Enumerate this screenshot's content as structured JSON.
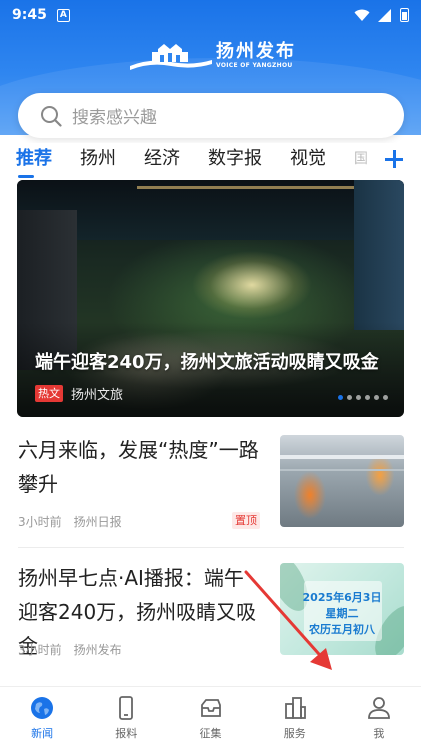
{
  "status_bar": {
    "time": "9:45",
    "notification_badge": "A"
  },
  "header": {
    "logo_title": "扬州发布",
    "logo_subtitle": "VOICE OF YANGZHOU",
    "brand_color": "#1a73e8"
  },
  "search": {
    "placeholder": "搜索感兴趣",
    "icon": "search-icon"
  },
  "tabs": {
    "items": [
      {
        "label": "推荐",
        "active": true
      },
      {
        "label": "扬州",
        "active": false
      },
      {
        "label": "经济",
        "active": false
      },
      {
        "label": "数字报",
        "active": false
      },
      {
        "label": "视觉",
        "active": false
      },
      {
        "label": "国",
        "active": false
      }
    ],
    "add_icon": "plus-icon"
  },
  "hero": {
    "title": "端午迎客240万，扬州文旅活动吸睛又吸金",
    "tag": "热文",
    "source": "扬州文旅",
    "slide_count": 6,
    "active_slide": 1
  },
  "news": [
    {
      "title": "六月来临，发展“热度”一路攀升",
      "time": "3小时前",
      "source": "扬州日报",
      "tag": "置顶",
      "thumb": "factory-robots-image"
    },
    {
      "title": "扬州早七点·AI播报：端午迎客240万，扬州吸睛又吸金",
      "time": "3小时前",
      "source": "扬州发布",
      "thumb": "calendar-image",
      "thumb_text": {
        "date": "2025年6月3日",
        "weekday": "星期二",
        "lunar": "农历五月初八"
      }
    }
  ],
  "bottom_nav": [
    {
      "label": "新闻",
      "icon": "globe-icon",
      "active": true
    },
    {
      "label": "报料",
      "icon": "phone-icon",
      "active": false
    },
    {
      "label": "征集",
      "icon": "inbox-icon",
      "active": false
    },
    {
      "label": "服务",
      "icon": "buildings-icon",
      "active": false
    },
    {
      "label": "我",
      "icon": "user-icon",
      "active": false
    }
  ],
  "colors": {
    "accent": "#1a73e8",
    "hot_tag": "#e53935",
    "arrow": "#e53935"
  }
}
